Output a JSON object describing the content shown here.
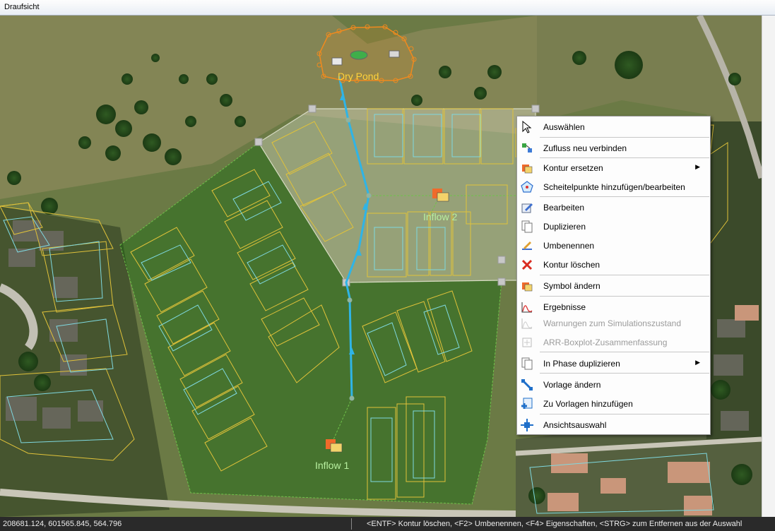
{
  "window": {
    "title": "Draufsicht"
  },
  "map": {
    "labels": {
      "dry_pond": "Dry Pond",
      "inflow_1": "Inflow 1",
      "inflow_2": "Inflow 2"
    },
    "colors": {
      "building_outline": "#e0c23a",
      "parcel_outline": "#7fd9e0",
      "flow_line": "#2fb4e6",
      "pond_selection": "#f08a1e",
      "label_text": "#b8f0a0",
      "pond_label": "#ffd23a"
    }
  },
  "context_menu": {
    "items": [
      {
        "label": "Auswählen",
        "icon": "cursor-arrow-icon",
        "enabled": true
      },
      {
        "label": "Zufluss neu verbinden",
        "icon": "reconnect-inflow-icon",
        "enabled": true
      },
      {
        "label": "Kontur ersetzen",
        "icon": "replace-contour-icon",
        "enabled": true,
        "submenu": true
      },
      {
        "label": "Scheitelpunkte hinzufügen/bearbeiten",
        "icon": "vertex-edit-icon",
        "enabled": true
      },
      {
        "label": "Bearbeiten",
        "icon": "edit-pencil-icon",
        "enabled": true
      },
      {
        "label": "Duplizieren",
        "icon": "duplicate-page-icon",
        "enabled": true
      },
      {
        "label": "Umbenennen",
        "icon": "rename-icon",
        "enabled": true
      },
      {
        "label": "Kontur löschen",
        "icon": "delete-x-icon",
        "enabled": true
      },
      {
        "label": "Symbol ändern",
        "icon": "change-symbol-icon",
        "enabled": true
      },
      {
        "label": "Ergebnisse",
        "icon": "results-chart-icon",
        "enabled": true
      },
      {
        "label": "Warnungen zum Simulationszustand",
        "icon": "warning-chart-icon",
        "enabled": false
      },
      {
        "label": "ARR-Boxplot-Zusammenfassung",
        "icon": "boxplot-icon",
        "enabled": false
      },
      {
        "label": "In Phase duplizieren",
        "icon": "duplicate-phase-icon",
        "enabled": true,
        "submenu": true
      },
      {
        "label": "Vorlage ändern",
        "icon": "change-template-icon",
        "enabled": true
      },
      {
        "label": "Zu Vorlagen hinzufügen",
        "icon": "add-template-icon",
        "enabled": true
      },
      {
        "label": "Ansichtsauswahl",
        "icon": "view-selection-icon",
        "enabled": true
      }
    ],
    "submenu_arrow": "▶"
  },
  "status": {
    "coordinates": "208681.124, 601565.845, 564.796",
    "hint": "<ENTF> Kontur löschen, <F2> Umbenennen, <F4> Eigenschaften, <STRG> zum Entfernen aus der Auswahl"
  }
}
